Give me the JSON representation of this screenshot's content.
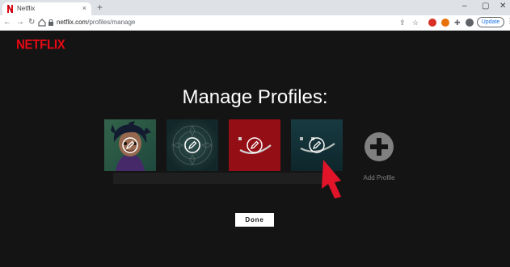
{
  "browser": {
    "tab_title": "Netflix",
    "tab_close": "×",
    "new_tab": "+",
    "window_controls": [
      "–",
      "▢",
      "✕"
    ],
    "url_host": "netflix.com",
    "url_path": "/profiles/manage",
    "update_label": "Update",
    "extension_colors": [
      "#d93025",
      "#e8710a",
      "#5f6368",
      "#8d6e63"
    ]
  },
  "app": {
    "logo": "NETFLIX",
    "heading": "Manage Profiles:",
    "profiles": [
      {
        "kind": "avatar-character",
        "color": "#4f9a72"
      },
      {
        "kind": "avatar-pattern",
        "color": "#2a5a5a"
      },
      {
        "kind": "avatar-smiley",
        "color": "#b5121b"
      },
      {
        "kind": "avatar-smiley",
        "color": "#1d4a52"
      }
    ],
    "add_profile_label": "Add Profile",
    "done_label": "Done"
  },
  "colors": {
    "brand": "#e50914",
    "background": "#141414",
    "annotation_arrow": "#e1142a"
  }
}
